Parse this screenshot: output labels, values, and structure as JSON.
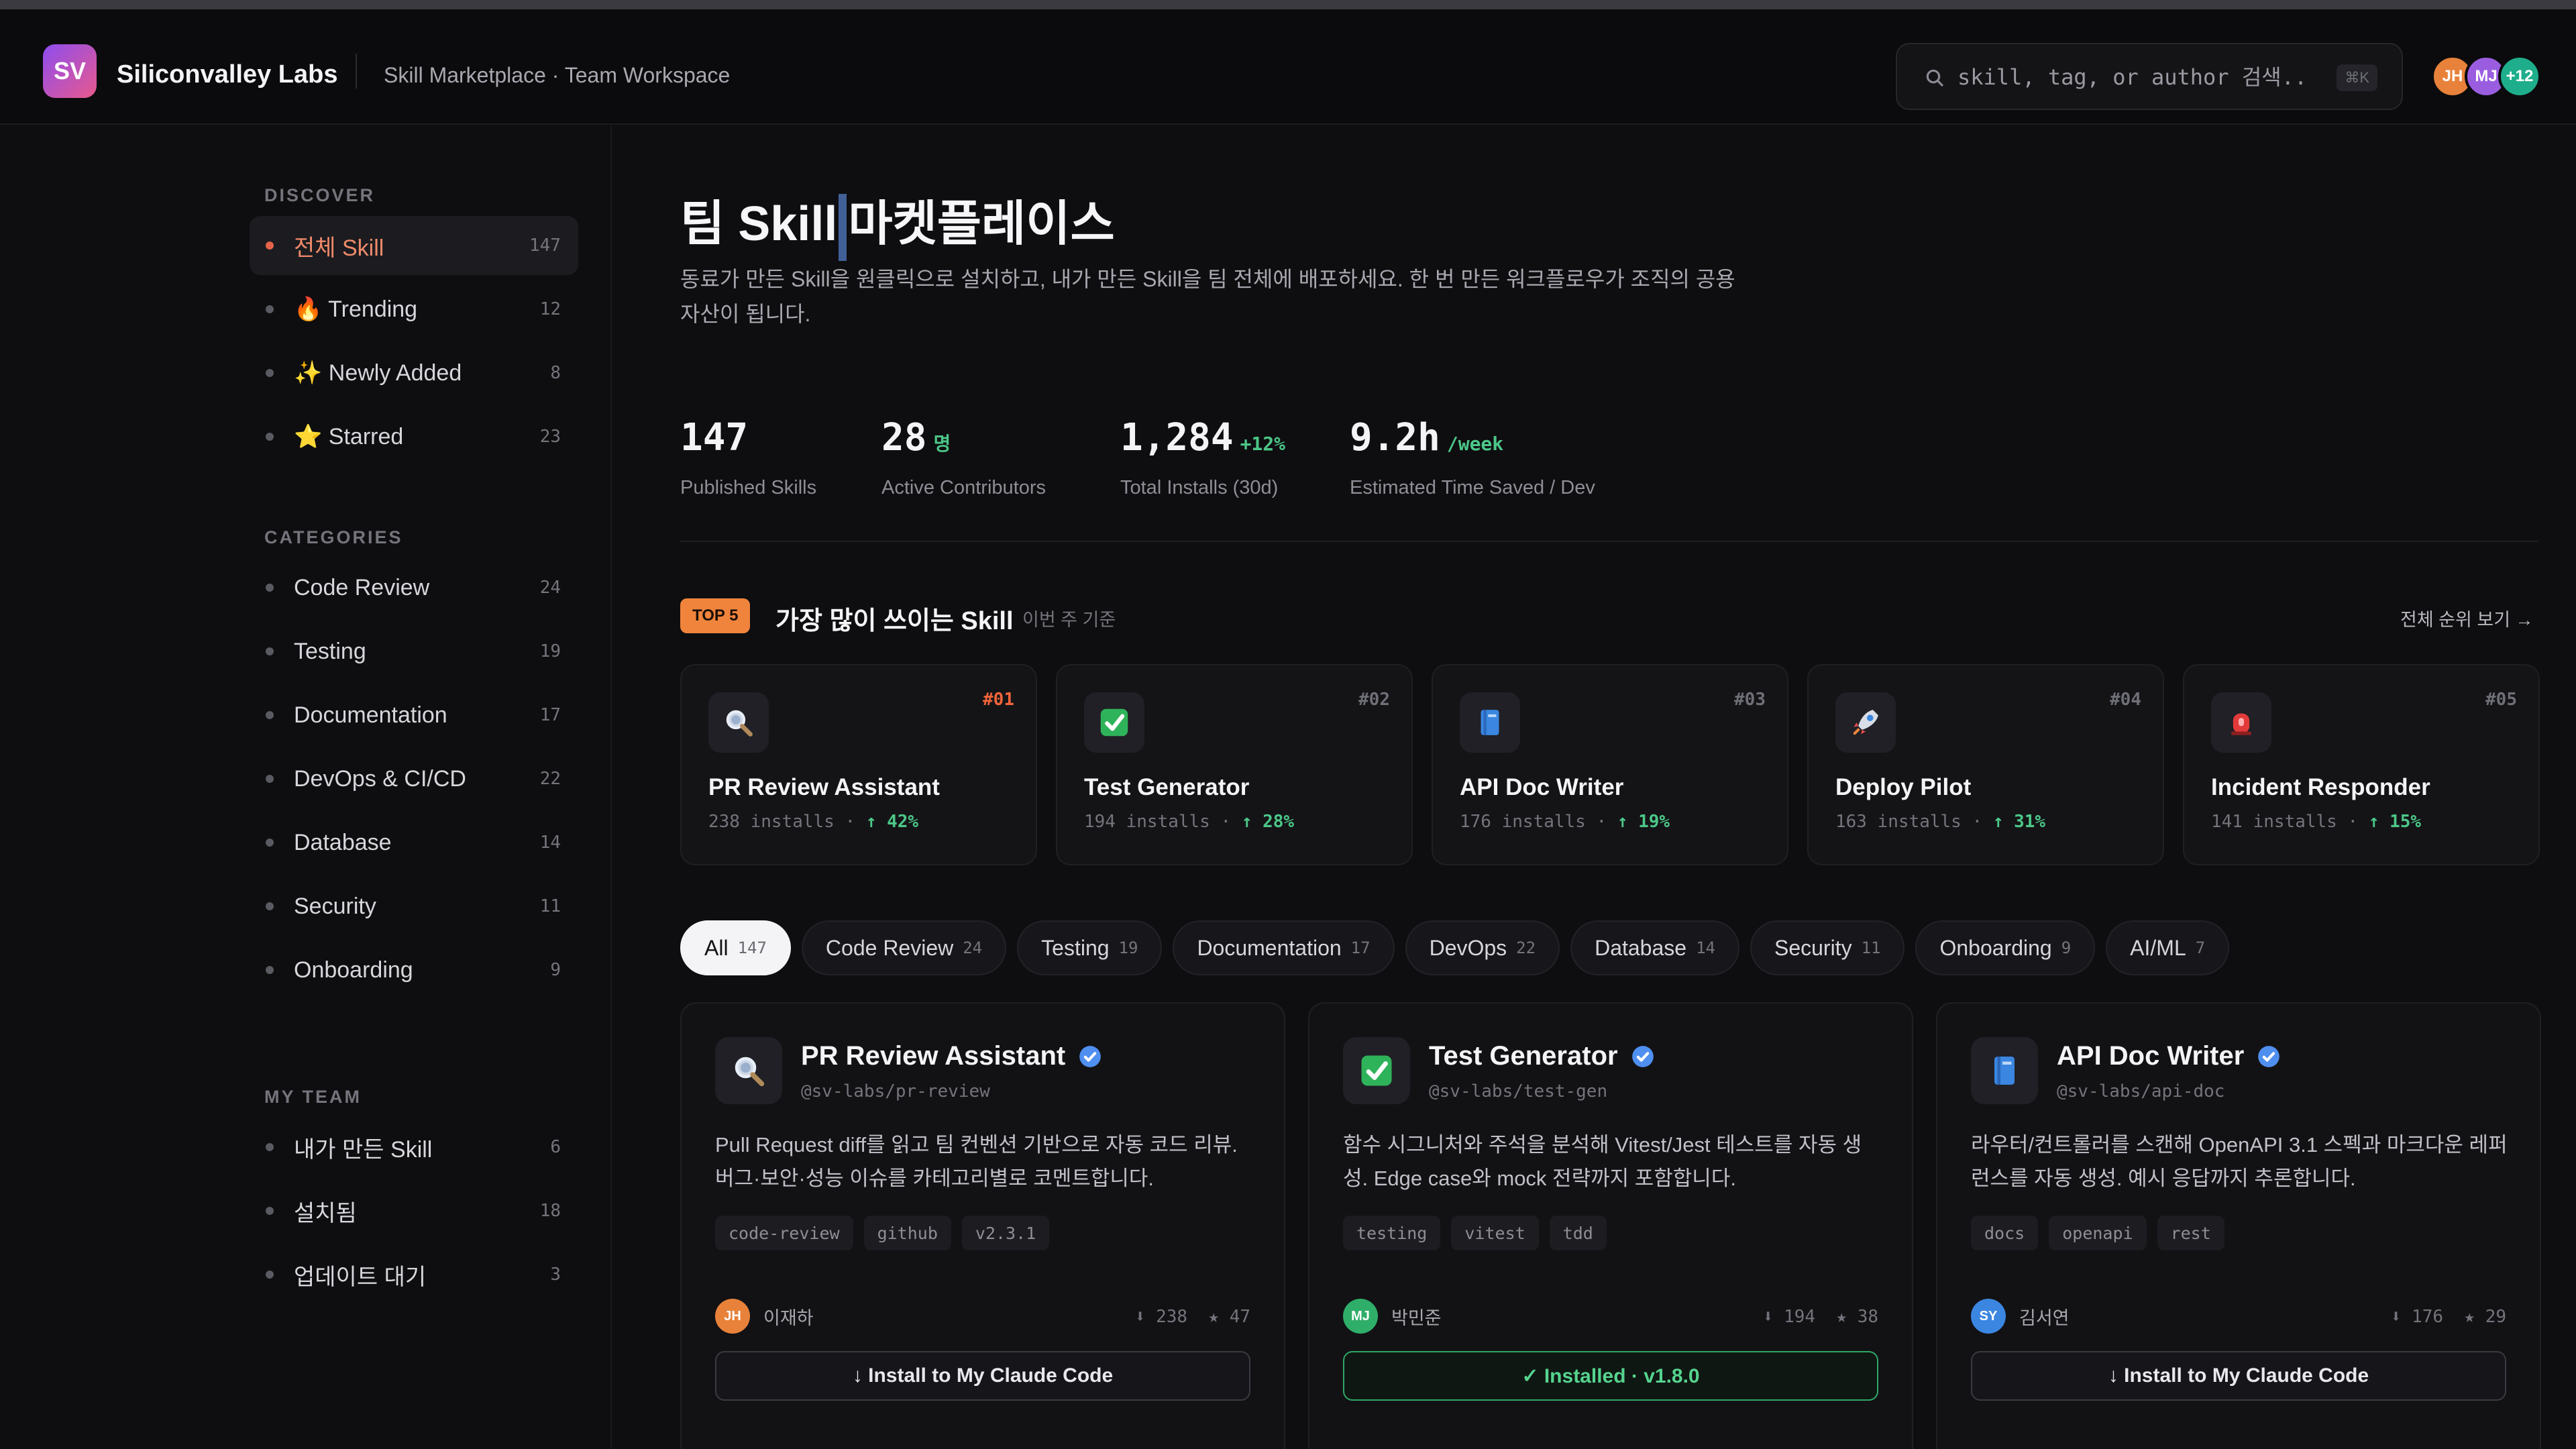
{
  "header": {
    "logo": "SV",
    "brand": "Siliconvalley Labs",
    "subtitle": "Skill Marketplace · Team Workspace",
    "search_placeholder": "skill, tag, or author 검색...",
    "search_shortcut": "⌘K",
    "avatars": [
      {
        "initials": "JH",
        "color": "#e8823a"
      },
      {
        "initials": "MJ",
        "color": "#9a5de0"
      },
      {
        "initials": "+12",
        "color": "#1fae8c"
      }
    ]
  },
  "sidebar": {
    "sections": [
      {
        "title": "DISCOVER",
        "items": [
          {
            "label": "전체 Skill",
            "count": "147",
            "active": true
          },
          {
            "label": "🔥 Trending",
            "count": "12"
          },
          {
            "label": "✨ Newly Added",
            "count": "8"
          },
          {
            "label": "⭐ Starred",
            "count": "23"
          }
        ]
      },
      {
        "title": "CATEGORIES",
        "items": [
          {
            "label": "Code Review",
            "count": "24"
          },
          {
            "label": "Testing",
            "count": "19"
          },
          {
            "label": "Documentation",
            "count": "17"
          },
          {
            "label": "DevOps & CI/CD",
            "count": "22"
          },
          {
            "label": "Database",
            "count": "14"
          },
          {
            "label": "Security",
            "count": "11"
          },
          {
            "label": "Onboarding",
            "count": "9"
          }
        ]
      },
      {
        "title": "MY TEAM",
        "items": [
          {
            "label": "내가 만든 Skill",
            "count": "6"
          },
          {
            "label": "설치됨",
            "count": "18"
          },
          {
            "label": "업데이트 대기",
            "count": "3"
          }
        ]
      }
    ]
  },
  "main": {
    "title_a": "팀 Skill",
    "title_b": "마켓플레이스",
    "description": "동료가 만든 Skill을 원클릭으로 설치하고, 내가 만든 Skill을 팀 전체에 배포하세요. 한 번 만든 워크플로우가 조직의 공용 자산이 됩니다.",
    "stats": [
      {
        "value": "147",
        "delta": "",
        "label": "Published Skills"
      },
      {
        "value": "28",
        "delta": "명",
        "label": "Active Contributors"
      },
      {
        "value": "1,284",
        "delta": "+12%",
        "label": "Total Installs (30d)"
      },
      {
        "value": "9.2h",
        "delta": "/week",
        "label": "Estimated Time Saved / Dev"
      }
    ],
    "top5": {
      "badge": "TOP 5",
      "title": "가장 많이 쓰이는 Skill",
      "subtitle": "이번 주 기준",
      "link": "전체 순위 보기 →",
      "items": [
        {
          "rank": "#01",
          "icon": "magnifier-icon",
          "name": "PR Review Assistant",
          "installs": "238 installs",
          "trend": "↑ 42%"
        },
        {
          "rank": "#02",
          "icon": "checkmark-icon",
          "name": "Test Generator",
          "installs": "194 installs",
          "trend": "↑ 28%"
        },
        {
          "rank": "#03",
          "icon": "book-icon",
          "name": "API Doc Writer",
          "installs": "176 installs",
          "trend": "↑ 19%"
        },
        {
          "rank": "#04",
          "icon": "rocket-icon",
          "name": "Deploy Pilot",
          "installs": "163 installs",
          "trend": "↑ 31%"
        },
        {
          "rank": "#05",
          "icon": "siren-icon",
          "name": "Incident Responder",
          "installs": "141 installs",
          "trend": "↑ 15%"
        }
      ]
    },
    "filters": [
      {
        "label": "All",
        "count": "147",
        "active": true
      },
      {
        "label": "Code Review",
        "count": "24"
      },
      {
        "label": "Testing",
        "count": "19"
      },
      {
        "label": "Documentation",
        "count": "17"
      },
      {
        "label": "DevOps",
        "count": "22"
      },
      {
        "label": "Database",
        "count": "14"
      },
      {
        "label": "Security",
        "count": "11"
      },
      {
        "label": "Onboarding",
        "count": "9"
      },
      {
        "label": "AI/ML",
        "count": "7"
      }
    ],
    "skills": [
      {
        "icon": "magnifier-icon",
        "name": "PR Review Assistant",
        "handle": "@sv-labs/pr-review",
        "description": "Pull Request diff를 읽고 팀 컨벤션 기반으로 자동 코드 리뷰. 버그·보안·성능 이슈를 카테고리별로 코멘트합니다.",
        "tags": [
          "code-review",
          "github",
          "v2.3.1"
        ],
        "author_initials": "JH",
        "author_color": "#e8823a",
        "author": "이재하",
        "installs": "238",
        "stars": "47",
        "button": "↓  Install to My Claude Code",
        "installed": false
      },
      {
        "icon": "checkmark-icon",
        "name": "Test Generator",
        "handle": "@sv-labs/test-gen",
        "description": "함수 시그니처와 주석을 분석해 Vitest/Jest 테스트를 자동 생성. Edge case와 mock 전략까지 포함합니다.",
        "tags": [
          "testing",
          "vitest",
          "tdd"
        ],
        "author_initials": "MJ",
        "author_color": "#2fae6a",
        "author": "박민준",
        "installs": "194",
        "stars": "38",
        "button": "✓  Installed · v1.8.0",
        "installed": true
      },
      {
        "icon": "book-icon",
        "name": "API Doc Writer",
        "handle": "@sv-labs/api-doc",
        "description": "라우터/컨트롤러를 스캔해 OpenAPI 3.1 스펙과 마크다운 레퍼런스를 자동 생성. 예시 응답까지 추론합니다.",
        "tags": [
          "docs",
          "openapi",
          "rest"
        ],
        "author_initials": "SY",
        "author_color": "#3b86e0",
        "author": "김서연",
        "installs": "176",
        "stars": "29",
        "button": "↓  Install to My Claude Code",
        "installed": false
      }
    ]
  }
}
